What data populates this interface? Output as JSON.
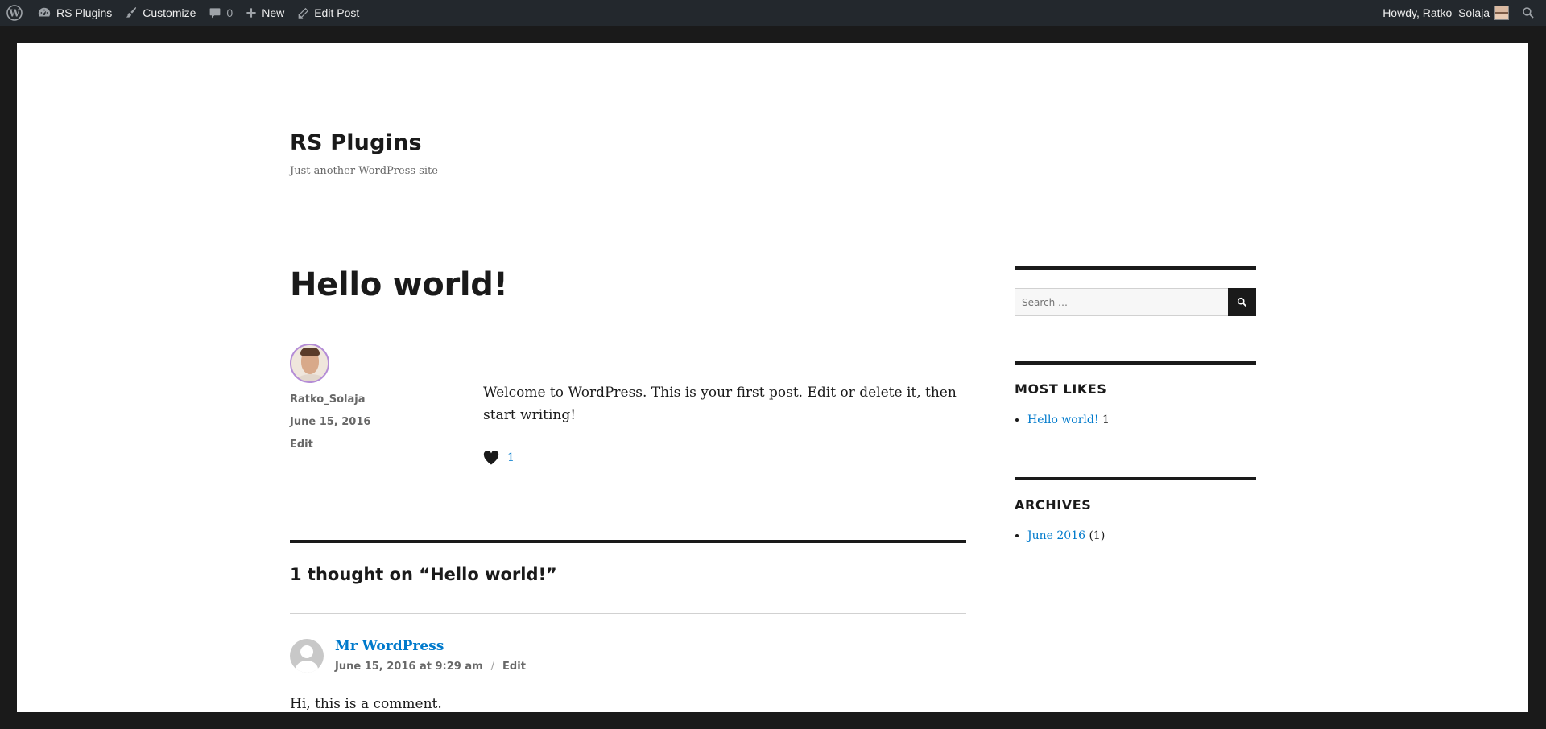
{
  "adminbar": {
    "site_name": "RS Plugins",
    "customize": "Customize",
    "comments_count": "0",
    "new": "New",
    "edit_post": "Edit Post",
    "howdy": "Howdy, Ratko_Solaja"
  },
  "site": {
    "title": "RS Plugins",
    "description": "Just another WordPress site"
  },
  "post": {
    "title": "Hello world!",
    "author": "Ratko_Solaja",
    "date": "June 15, 2016",
    "edit": "Edit",
    "content": "Welcome to WordPress. This is your first post. Edit or delete it, then start writing!",
    "likes": "1"
  },
  "comments": {
    "title": "1 thought on “Hello world!”",
    "items": [
      {
        "author": "Mr WordPress",
        "date": "June 15, 2016 at 9:29 am",
        "sep": "/",
        "edit": "Edit",
        "text": "Hi, this is a comment."
      }
    ]
  },
  "sidebar": {
    "search_placeholder": "Search …",
    "most_likes": {
      "title": "MOST LIKES",
      "items": [
        {
          "label": "Hello world!",
          "count": "1"
        }
      ]
    },
    "archives": {
      "title": "ARCHIVES",
      "items": [
        {
          "label": "June 2016",
          "count": "(1)"
        }
      ]
    }
  },
  "colors": {
    "link": "#007acc",
    "adminbar": "#23282d",
    "text": "#1a1a1a"
  }
}
